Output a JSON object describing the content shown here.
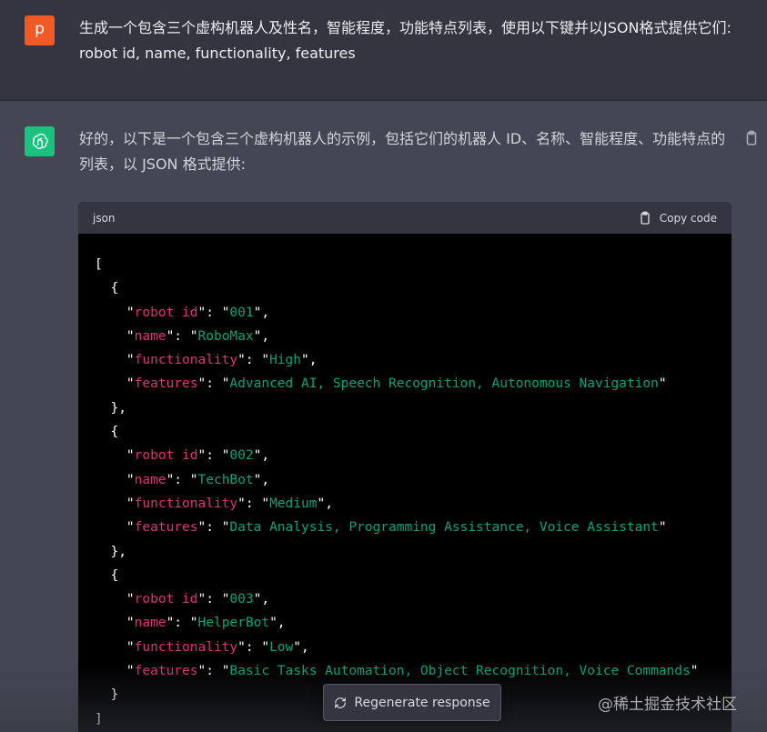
{
  "user_message": {
    "avatar_letter": "p",
    "text": "生成一个包含三个虚构机器人及性名，智能程度，功能特点列表，使用以下键并以JSON格式提供它们: robot id, name, functionality, features"
  },
  "assistant_message": {
    "intro": "好的，以下是一个包含三个虚构机器人的示例，包括它们的机器人 ID、名称、智能程度、功能特点的列表，以 JSON 格式提供:",
    "code_block": {
      "language": "json",
      "copy_label": "Copy code",
      "open_bracket": "[",
      "close_bracket": "]",
      "robots": [
        {
          "robot_id_key": "robot id",
          "robot_id": "001",
          "name_key": "name",
          "name": "RoboMax",
          "functionality_key": "functionality",
          "functionality": "High",
          "features_key": "features",
          "features": "Advanced AI, Speech Recognition, Autonomous Navigation"
        },
        {
          "robot_id_key": "robot id",
          "robot_id": "002",
          "name_key": "name",
          "name": "TechBot",
          "functionality_key": "functionality",
          "functionality": "Medium",
          "features_key": "features",
          "features": "Data Analysis, Programming Assistance, Voice Assistant"
        },
        {
          "robot_id_key": "robot id",
          "robot_id": "003",
          "name_key": "name",
          "name": "HelperBot",
          "functionality_key": "functionality",
          "functionality": "Low",
          "features_key": "features",
          "features": "Basic Tasks Automation, Object Recognition, Voice Commands"
        }
      ]
    }
  },
  "regenerate_button": {
    "label": "Regenerate response"
  },
  "watermark": "@稀土掘金技术社区",
  "colors": {
    "user_bg": "#343541",
    "assistant_bg": "#444654",
    "user_avatar": "#f15a24",
    "gpt_avatar": "#19c37d",
    "json_key": "#df3079",
    "json_string": "#00a67d"
  }
}
